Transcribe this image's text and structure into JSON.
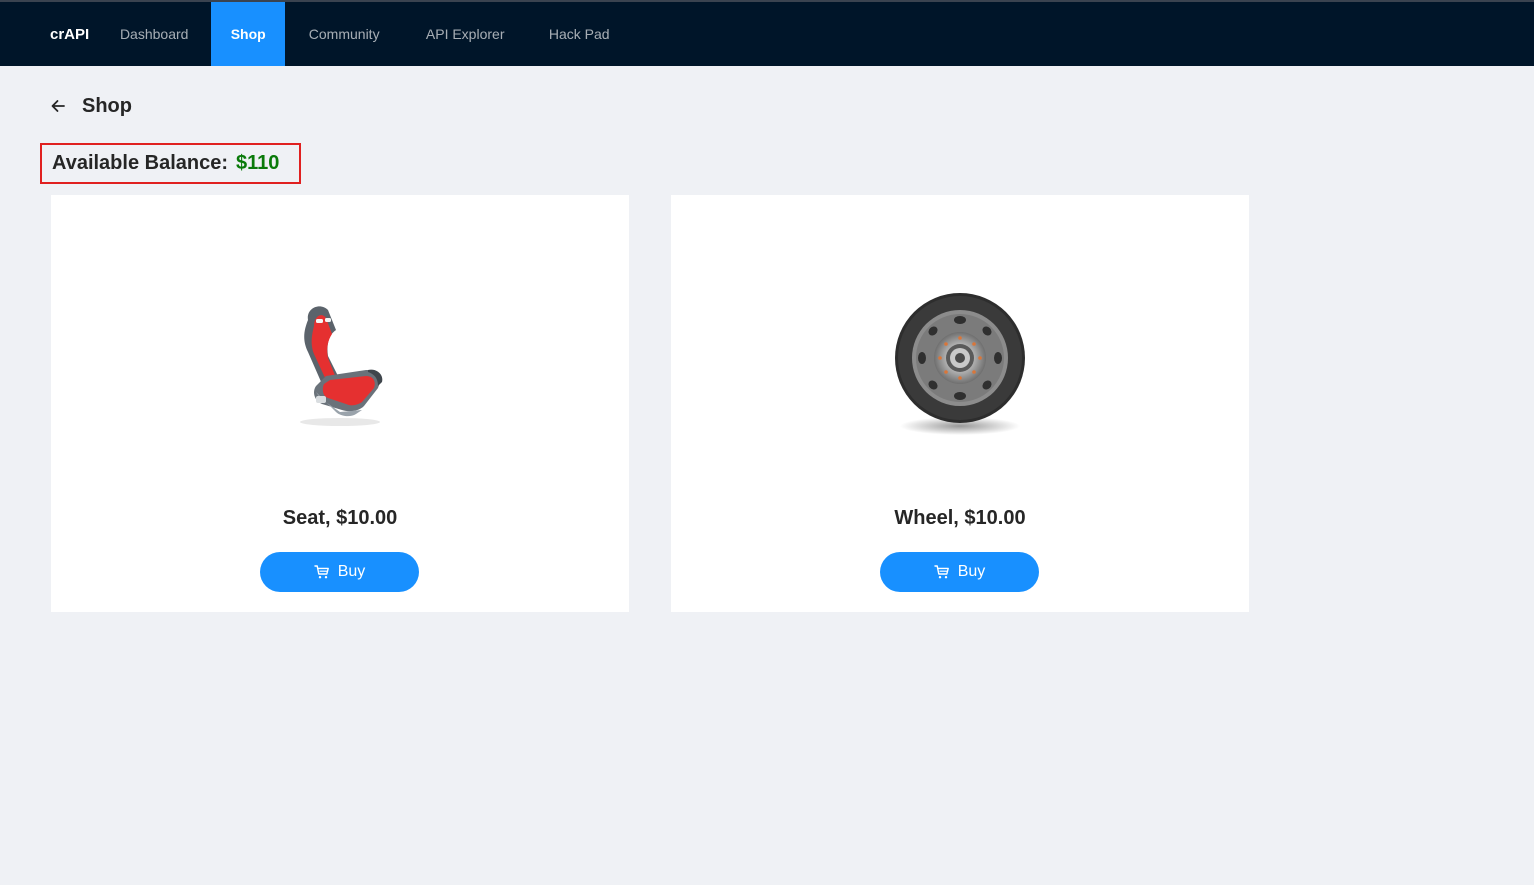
{
  "nav": {
    "brand": "crAPI",
    "items": [
      {
        "label": "Dashboard",
        "active": false
      },
      {
        "label": "Shop",
        "active": true
      },
      {
        "label": "Community",
        "active": false
      },
      {
        "label": "API Explorer",
        "active": false
      },
      {
        "label": "Hack Pad",
        "active": false
      }
    ]
  },
  "page": {
    "title": "Shop",
    "back_icon": "arrow-left-icon"
  },
  "balance": {
    "label": "Available Balance:",
    "amount": "$110"
  },
  "products": [
    {
      "name": "Seat, $10.00",
      "image_icon": "seat-icon",
      "buy_label": "Buy"
    },
    {
      "name": "Wheel, $10.00",
      "image_icon": "wheel-icon",
      "buy_label": "Buy"
    }
  ],
  "colors": {
    "nav_bg": "#001529",
    "accent": "#1890ff",
    "balance_amount": "#0a7a0a",
    "balance_border": "#e02020"
  }
}
